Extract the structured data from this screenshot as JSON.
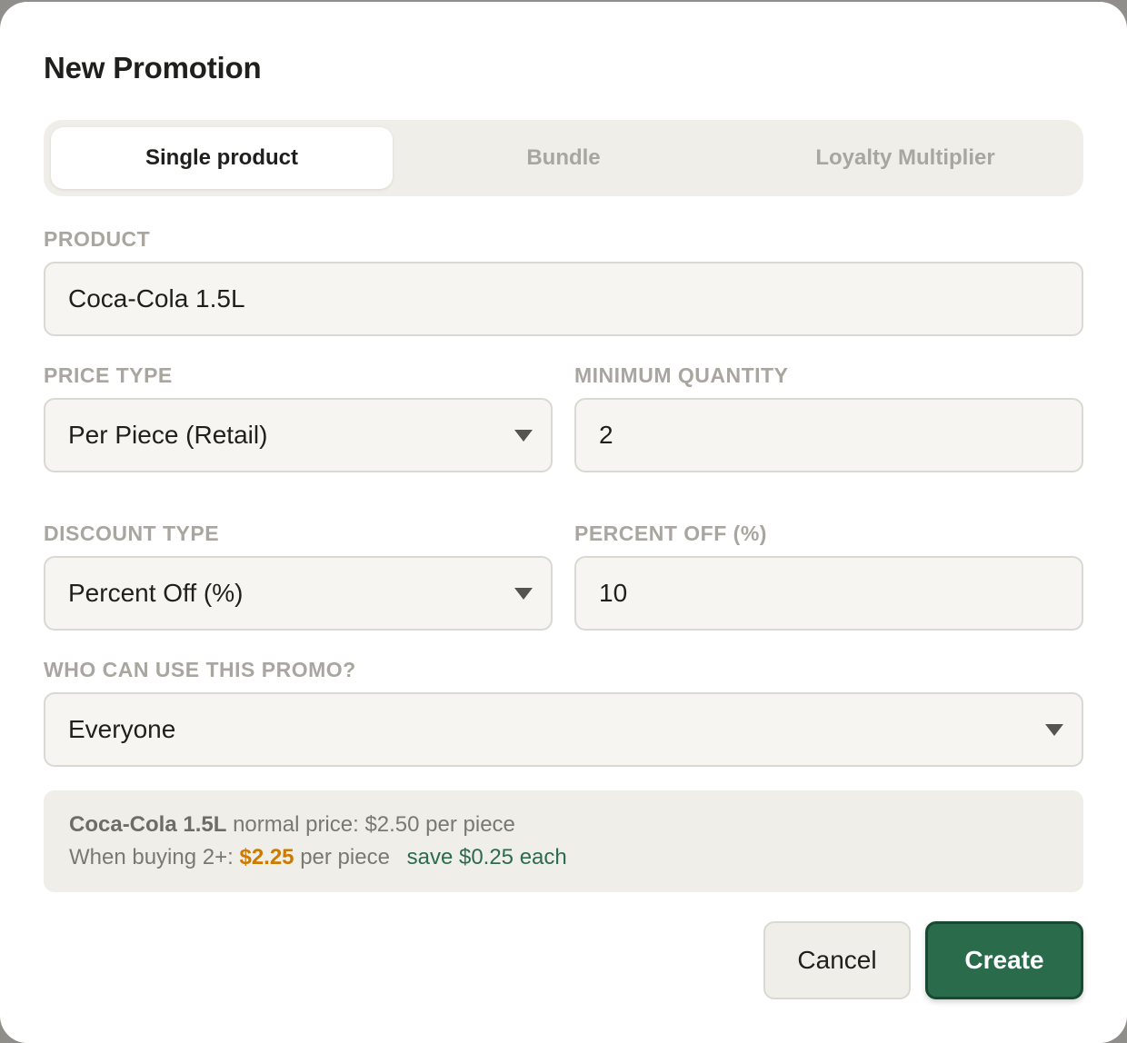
{
  "dialog": {
    "title": "New Promotion"
  },
  "tabs": [
    {
      "label": "Single product",
      "active": true
    },
    {
      "label": "Bundle",
      "active": false
    },
    {
      "label": "Loyalty Multiplier",
      "active": false
    }
  ],
  "form": {
    "product": {
      "label": "PRODUCT",
      "value": "Coca-Cola 1.5L"
    },
    "price_type": {
      "label": "PRICE TYPE",
      "value": "Per Piece (Retail)"
    },
    "minimum_quantity": {
      "label": "MINIMUM QUANTITY",
      "value": "2"
    },
    "discount_type": {
      "label": "DISCOUNT TYPE",
      "value": "Percent Off (%)"
    },
    "percent_off": {
      "label": "PERCENT OFF (%)",
      "value": "10"
    },
    "audience": {
      "label": "WHO CAN USE THIS PROMO?",
      "value": "Everyone"
    }
  },
  "summary": {
    "product_name": "Coca-Cola 1.5L",
    "normal_price_text": "normal price: $2.50 per piece",
    "when_buying_text": "When buying 2+:",
    "promo_price": "$2.25",
    "per_piece_text": "per piece",
    "save_text": "save $0.25 each"
  },
  "buttons": {
    "cancel": "Cancel",
    "create": "Create"
  },
  "colors": {
    "accent": "#2a6b4c",
    "promo_price": "#cc7a00",
    "save_text": "#2d6b4d"
  }
}
